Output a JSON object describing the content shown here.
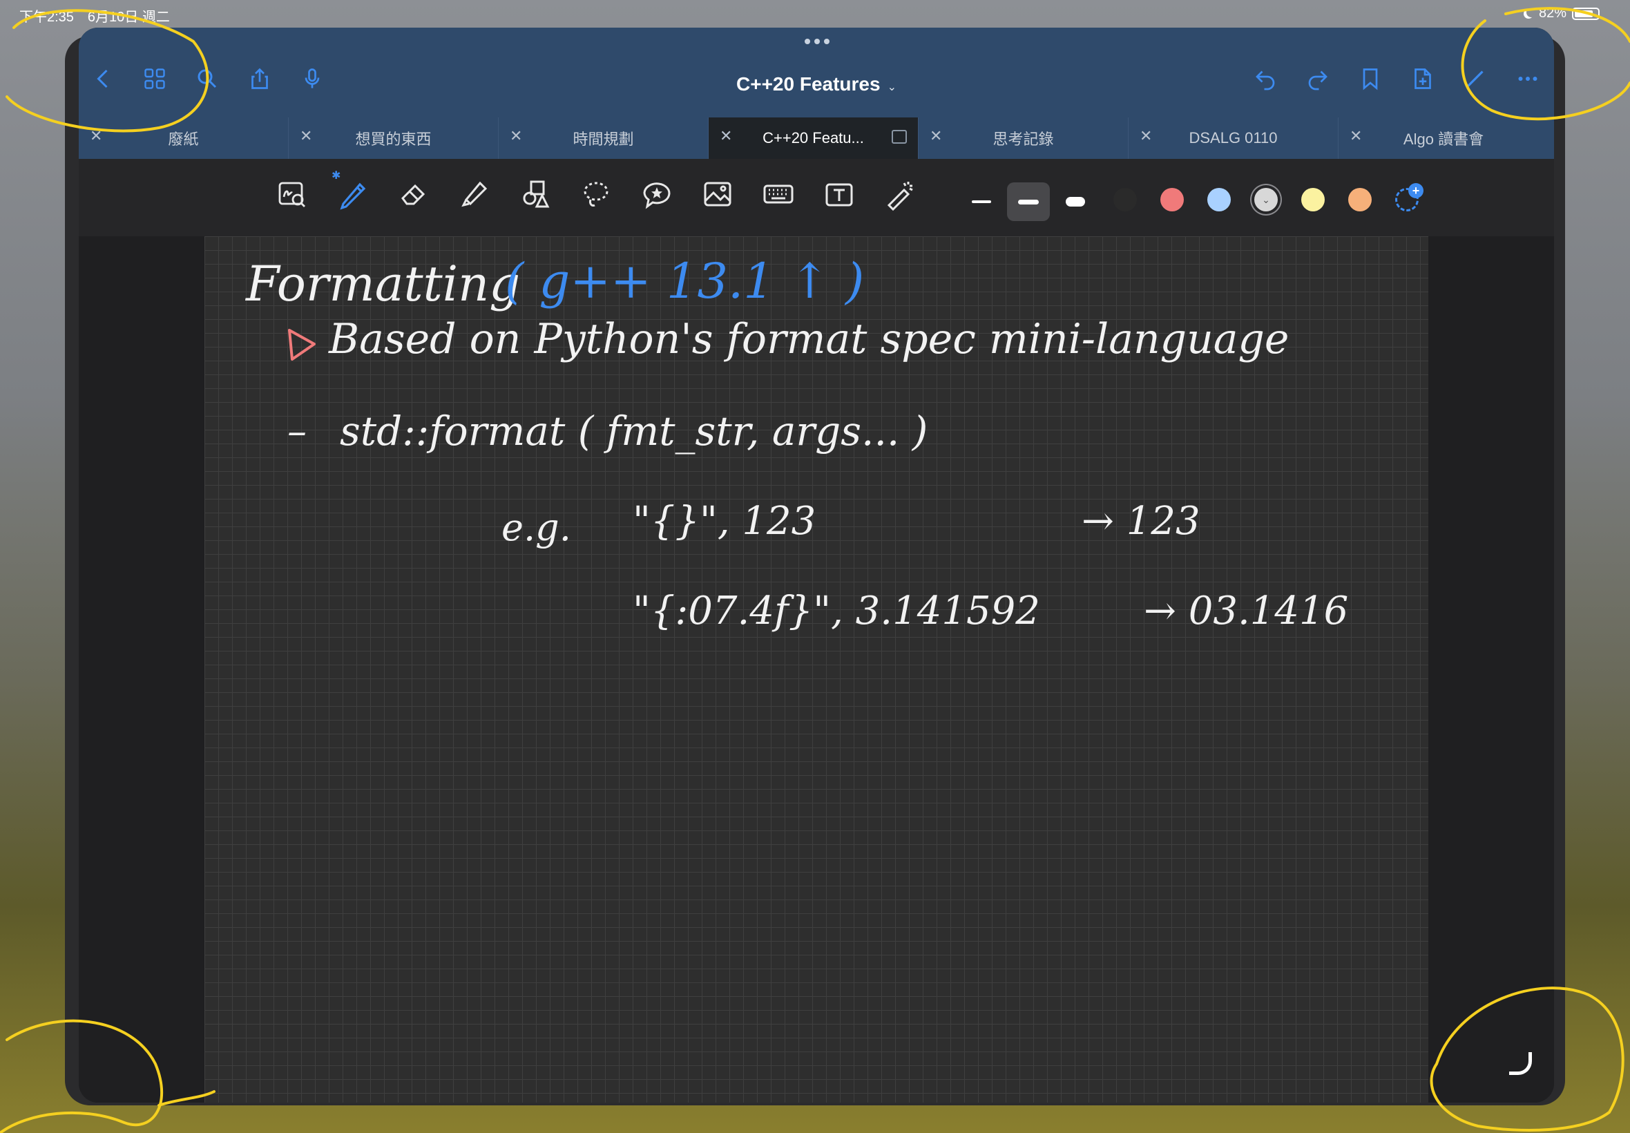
{
  "status_bar": {
    "time_date": "下午2:35　6月10日 週二",
    "battery": "82%",
    "battery_level": 0.82
  },
  "document": {
    "title": "C++20 Features"
  },
  "toolbar_icons": {
    "back": "chevron-left-icon",
    "thumbnails": "grid-icon",
    "search": "search-icon",
    "share": "share-icon",
    "mic": "mic-icon",
    "undo": "undo-icon",
    "redo": "redo-icon",
    "bookmark": "bookmark-icon",
    "add_page": "add-page-icon",
    "pen_mode": "pencil-icon",
    "more": "more-icon"
  },
  "tabs": [
    {
      "label": "廢紙"
    },
    {
      "label": "想買的東西"
    },
    {
      "label": "時間規劃"
    },
    {
      "label": "C++20 Featu...",
      "active": true
    },
    {
      "label": "思考記錄"
    },
    {
      "label": "DSALG 0110"
    },
    {
      "label": "Algo 讀書會"
    }
  ],
  "tools": [
    "zoom-window-icon",
    "pen-icon",
    "eraser-icon",
    "highlighter-icon",
    "shapes-icon",
    "lasso-icon",
    "sticker-icon",
    "image-icon",
    "keyboard-icon",
    "text-icon",
    "laser-pointer-icon"
  ],
  "colors": {
    "swatches": [
      "#2a2a2a",
      "#f07a7a",
      "#a9d1ff",
      "#d8d8d8",
      "#fbf2a0",
      "#f6b07a"
    ],
    "selected_index": 3,
    "accent": "#3d8bf0",
    "ink_white": "#f2f2f2",
    "ink_blue": "#3d8bf0",
    "ink_red": "#f07a7a",
    "annotation": "#f5d020"
  },
  "note": {
    "heading": "Formatting",
    "heading_note": "( g++ 13.1 ↑ )",
    "bullet": "Based on Python's format spec mini-language",
    "line1": "std::format ( fmt_str, args... )",
    "eg_label": "e.g.",
    "ex1_args": "\"{}\", 123",
    "ex1_result": "→ 123",
    "ex2_args": "\"{:07.4f}\", 3.141592",
    "ex2_result": "→ 03.1416"
  }
}
